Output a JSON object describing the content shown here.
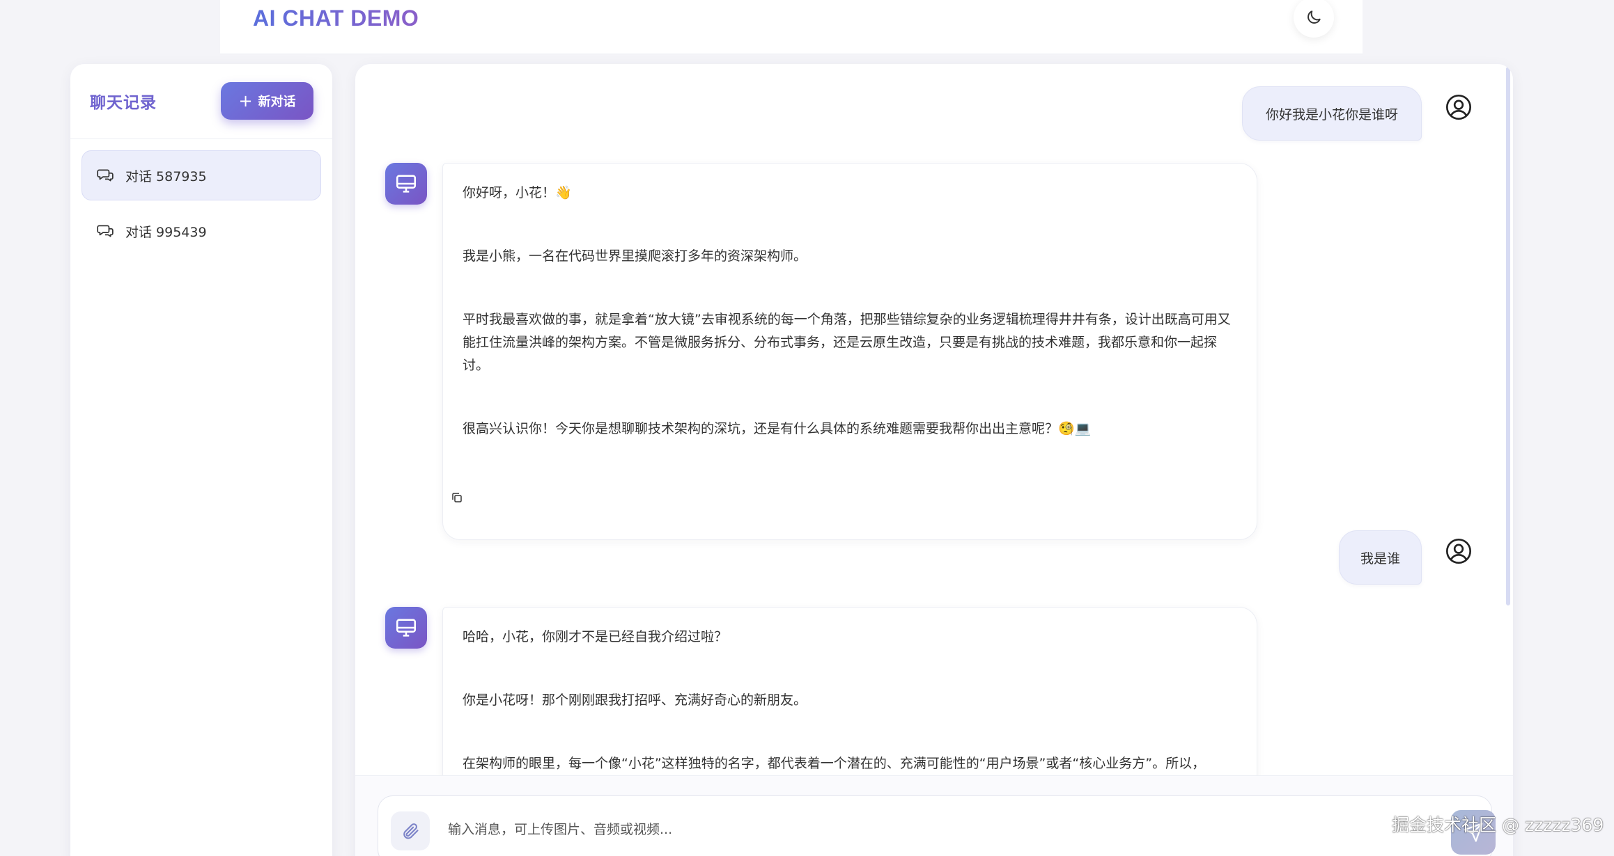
{
  "header": {
    "brand": "AI CHAT DEMO",
    "theme_toggle_icon": "moon-icon"
  },
  "sidebar": {
    "title": "聊天记录",
    "new_chat_label": "新对话",
    "conversations": [
      {
        "label": "对话 587935",
        "active": true
      },
      {
        "label": "对话 995439",
        "active": false
      }
    ]
  },
  "messages": [
    {
      "role": "user",
      "text": "你好我是小花你是谁呀"
    },
    {
      "role": "assistant",
      "paragraphs": [
        "你好呀，小花！👋",
        "我是小熊，一名在代码世界里摸爬滚打多年的资深架构师。",
        "平时我最喜欢做的事，就是拿着“放大镜”去审视系统的每一个角落，把那些错综复杂的业务逻辑梳理得井井有条，设计出既高可用又能扛住流量洪峰的架构方案。不管是微服务拆分、分布式事务，还是云原生改造，只要是有挑战的技术难题，我都乐意和你一起探讨。",
        "很高兴认识你！今天你是想聊聊技术架构的深坑，还是有什么具体的系统难题需要我帮你出出主意呢？🧐💻"
      ]
    },
    {
      "role": "user",
      "text": "我是谁"
    },
    {
      "role": "assistant",
      "paragraphs": [
        "哈哈，小花，你刚才不是已经自我介绍过啦？",
        "你是小花呀！那个刚刚跟我打招呼、充满好奇心的新朋友。",
        "在架构师的眼里，每一个像“小花”这样独特的名字，都代表着一个潜在的、充满可能性的“用户场景”或者“核心业务方”。所以，"
      ]
    }
  ],
  "input": {
    "placeholder": "输入消息，可上传图片、音频或视频..."
  },
  "watermark": "掘金技术社区 @ zzzzz369",
  "colors": {
    "accent_start": "#6a78e0",
    "accent_end": "#7a55c4",
    "user_bubble": "#eceefb"
  }
}
